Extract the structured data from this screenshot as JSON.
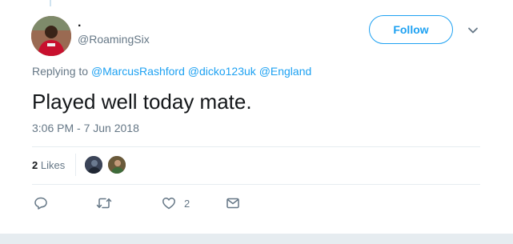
{
  "author": {
    "display_name": ".",
    "handle": "@RoamingSix",
    "avatar_icon": "user-avatar-photo"
  },
  "header": {
    "follow_label": "Follow",
    "menu_icon": "chevron-down-icon"
  },
  "replying": {
    "prefix": "Replying to",
    "mentions": [
      "@MarcusRashford",
      "@dicko123uk",
      "@England"
    ]
  },
  "tweet": {
    "text": "Played well today mate.",
    "timestamp": "3:06 PM - 7 Jun 2018"
  },
  "stats": {
    "likes_count": "2",
    "likes_label": "Likes"
  },
  "actions": {
    "reply_icon": "reply-icon",
    "retweet_icon": "retweet-icon",
    "like_icon": "heart-icon",
    "like_count": "2",
    "dm_icon": "envelope-icon"
  },
  "colors": {
    "accent": "#1da1f2",
    "muted": "#657786",
    "text": "#14171a",
    "border": "#e6ecf0"
  }
}
